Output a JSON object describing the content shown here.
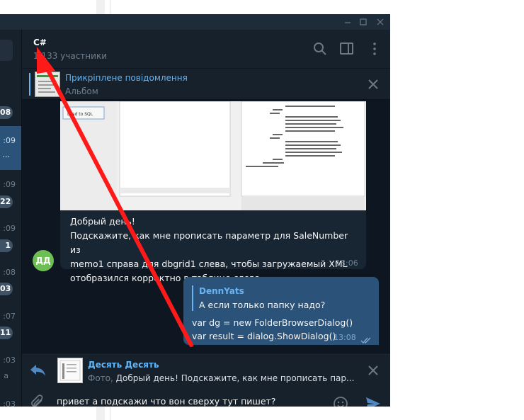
{
  "sidebar": {
    "items": [
      {
        "time": "",
        "badge": "08"
      },
      {
        "time": ":09",
        "badge": "",
        "dots": "..."
      },
      {
        "time": ":09",
        "badge": "22"
      },
      {
        "time": ":09",
        "badge": "1"
      },
      {
        "time": ":08",
        "badge": "03"
      },
      {
        "time": ":07",
        "badge": "11"
      },
      {
        "time": ":03",
        "text": "а"
      },
      {
        "time": ":03",
        "badge": ""
      }
    ]
  },
  "header": {
    "title": "C#",
    "subtitle": "1 133 участники"
  },
  "pinned": {
    "title": "Прикріплене повідомлення",
    "subtitle": "Альбом"
  },
  "messages": {
    "incoming": {
      "avatar_initials": "ДД",
      "line1": "Добрый день!",
      "line2": "Подскажите, как мне прописать параметр для SaleNumber из",
      "line3": "memo1 справа для dbgrid1 слева, чтобы загружаемый XML",
      "line4": "отобразился корректно в таблице слева",
      "time": "13:06",
      "image_button": "Load to SQL"
    },
    "outgoing": {
      "reply_author": "DennYats",
      "reply_text": "А если только папку надо?",
      "line1": "var dg = new FolderBrowserDialog()",
      "line2": "var result = dialog.ShowDialog()",
      "time": "13:08"
    }
  },
  "reply_preview": {
    "author": "Десять Десять",
    "label": "Фото,",
    "text": " Добрый день!  Подскажите, как мне прописать пар..."
  },
  "composer": {
    "value": "привет а подскажи что вон сверху тут пишет?"
  },
  "colors": {
    "accent": "#5eb5f7",
    "outgoing_bubble": "#2b5278",
    "incoming_bubble": "#182533",
    "arrow": "#ff1a1a"
  }
}
